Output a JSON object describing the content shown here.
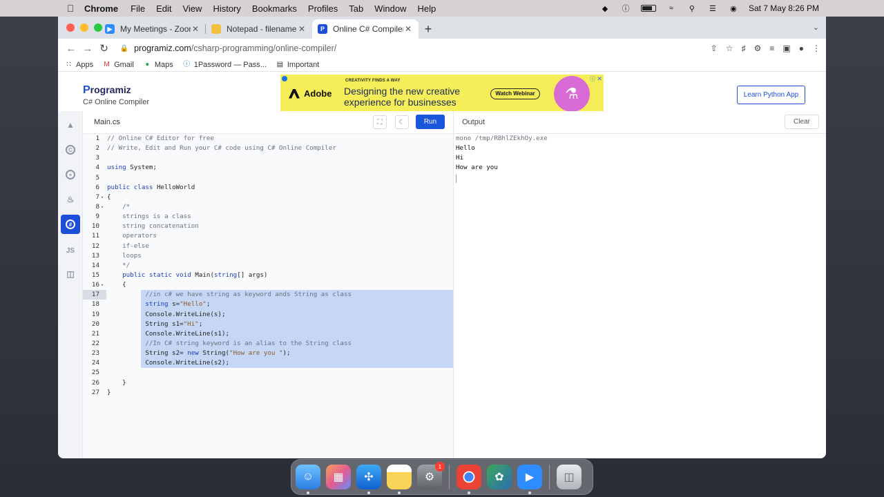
{
  "menubar": {
    "app": "Chrome",
    "items": [
      "File",
      "Edit",
      "View",
      "History",
      "Bookmarks",
      "Profiles",
      "Tab",
      "Window",
      "Help"
    ],
    "datetime": "Sat 7 May  8:26 PM"
  },
  "browser": {
    "tabs": [
      {
        "label": "My Meetings - Zoom",
        "icon": "zoom-icon",
        "color": "#2d8cff"
      },
      {
        "label": "Notepad - filename.txt",
        "icon": "notepad-icon",
        "color": "#f0c040"
      },
      {
        "label": "Online C# Compiler (Editor)",
        "icon": "programiz-icon",
        "color": "#1d4ed8"
      }
    ],
    "url_host": "programiz.com",
    "url_path": "/csharp-programming/online-compiler/",
    "bookmarks": [
      "Apps",
      "Gmail",
      "Maps",
      "1Password — Pass...",
      "Important"
    ]
  },
  "site": {
    "logo": "rogramiz",
    "logo_p": "P",
    "subtitle": "C# Online Compiler",
    "learn_button": "Learn Python App",
    "ad": {
      "brand": "Adobe",
      "tagline": "CREATIVITY FINDS A WAY",
      "headline": "Designing the new creative experience for businesses",
      "cta": "Watch Webinar"
    }
  },
  "editor": {
    "file_name": "Main.cs",
    "run_label": "Run",
    "lines": [
      {
        "n": "1",
        "html": "<span class='cm'>// Online C# Editor for free</span>"
      },
      {
        "n": "2",
        "html": "<span class='cm'>// Write, Edit and Run your C# code using C# Online Compiler</span>"
      },
      {
        "n": "3",
        "html": ""
      },
      {
        "n": "4",
        "html": "<span class='kw'>using</span> System;"
      },
      {
        "n": "5",
        "html": ""
      },
      {
        "n": "6",
        "html": "<span class='kw'>public</span> <span class='kw'>class</span> HelloWorld"
      },
      {
        "n": "7",
        "html": "{",
        "fold": true
      },
      {
        "n": "8",
        "html": "    <span class='cm'>/*</span>",
        "fold": true
      },
      {
        "n": "9",
        "html": "    <span class='cm'>strings is a class</span>"
      },
      {
        "n": "10",
        "html": "    <span class='cm'>string concatenation</span>"
      },
      {
        "n": "11",
        "html": "    <span class='cm'>operators</span>"
      },
      {
        "n": "12",
        "html": "    <span class='cm'>if-else</span>"
      },
      {
        "n": "13",
        "html": "    <span class='cm'>loops</span>"
      },
      {
        "n": "14",
        "html": "    <span class='cm'>*/</span>"
      },
      {
        "n": "15",
        "html": "    <span class='kw'>public</span> <span class='kw'>static</span> <span class='kw'>void</span> Main(<span class='kw'>string</span>[] args)"
      },
      {
        "n": "16",
        "html": "    {",
        "fold": true
      },
      {
        "n": "17",
        "html": "          <span class='cm'>//in c# we have string as keyword ands String as class</span>",
        "sel": true,
        "cur": true
      },
      {
        "n": "18",
        "html": "          <span class='kw'>string</span> s=<span class='st'>\"Hello\"</span>;",
        "sel": true
      },
      {
        "n": "19",
        "html": "          Console.WriteLine(s);",
        "sel": true
      },
      {
        "n": "20",
        "html": "          String s1=<span class='st'>\"Hi\"</span>;",
        "sel": true
      },
      {
        "n": "21",
        "html": "          Console.WriteLine(s1);",
        "sel": true
      },
      {
        "n": "22",
        "html": "          <span class='cm'>//In C# string keyword is an alias to the String class</span>",
        "sel": true
      },
      {
        "n": "23",
        "html": "          String s2= <span class='kw'>new</span> String(<span class='st'>\"How are you \"</span>);",
        "sel": true
      },
      {
        "n": "24",
        "html": "          Console.WriteLine(s2);",
        "sel": true
      },
      {
        "n": "25",
        "html": ""
      },
      {
        "n": "26",
        "html": "    }"
      },
      {
        "n": "27",
        "html": "}"
      }
    ]
  },
  "output": {
    "title": "Output",
    "clear_label": "Clear",
    "lines": [
      "mono /tmp/RBhlZEkhOy.exe",
      "Hello",
      "Hi",
      "How are you"
    ]
  },
  "languages": [
    "python",
    "c",
    "cpp",
    "java",
    "csharp",
    "js",
    "sql"
  ],
  "dock": {
    "settings_badge": "1"
  }
}
